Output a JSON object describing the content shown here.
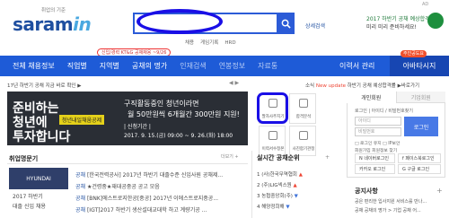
{
  "header": {
    "tagline": "취업의 기준",
    "logo_text": "saram",
    "logo_suffix": "in",
    "search_placeholder": "",
    "advanced_search": "상세검색",
    "sublinks": [
      "채용",
      "게임기록",
      "HRD"
    ],
    "promo_badge": "신입/경력 KT&G 공채채용 ~9/26",
    "ad_line1": "2017 하반기 공채 예상합격",
    "ad_line2": "미리 미리 준비하세요!",
    "ad_tag": "AD"
  },
  "nav": {
    "items": [
      "전체 채용정보",
      "직업별",
      "지역별",
      "공채의 명가",
      "인재검색",
      "연봉정보",
      "자료통"
    ],
    "dim_from": 4,
    "resume": "이력서 관리",
    "partner": "아바타시지",
    "partner_badge": "주인공도요"
  },
  "notices": {
    "left": "17년 하반기 공채 지금 바로 확인 ▶",
    "right_prefix": "소식",
    "right_highlight": "New update",
    "right_text": "하반기 공채 예상합격률 ▶바로가기"
  },
  "banner": {
    "line1": "준비하는",
    "line2": "청년에",
    "line3": "투자합니다",
    "tag": "청년내일채움공제",
    "r1": "구직활동중인 청년이라면",
    "r2": "월 50만원씩 6개월간 300만원 지원!",
    "r3": "| 신청기간 |",
    "r4": "2017. 9. 15.(금) 09:00 ~ 9. 26.(화) 18:00",
    "nav_text": "◀  ▶"
  },
  "tiles": [
    {
      "icon": "chart-icon",
      "label": "팔자사주지기"
    },
    {
      "icon": "check-icon",
      "label": "합격분석"
    },
    {
      "icon": "doc-icon",
      "label": "이력서수정본"
    },
    {
      "icon": "mail-icon",
      "label": "사진합기관정"
    }
  ],
  "login": {
    "tab_personal": "개인회원",
    "tab_company": "기업회원",
    "options": "로그인 | 아이디 / 비밀번호찾기",
    "id_placeholder": "아이디",
    "pw_placeholder": "비밀번호",
    "login_button": "로그인",
    "keep_login": "□ 로그인 유지   □ IP보안",
    "join": "회원가입    회원정보 찾기",
    "sns": [
      "N 네이버로그인",
      "f 페이스북로그인",
      "카카오 로그인",
      "G 구글 로그인"
    ]
  },
  "company_section": {
    "title": "취업명문기",
    "more": "더보기 +",
    "logo_text": "HYUNDAI",
    "caption1": "2017 하반기",
    "caption2": "대졸 신입 채용",
    "rows": [
      {
        "tag": "공채",
        "text": "[한국전력공사] 2017년 하반기 대졸수준 신입사원 공채제..."
      },
      {
        "tag": "공채",
        "text": "★건령중★재대공중공 공고 모음"
      },
      {
        "tag": "공채",
        "text": "[BNK]에스트로지한공[중공] 2017년 이에스트로지중공..."
      },
      {
        "tag": "공채",
        "text": "[IGT]2017 하반기 생산설대교대학 하고 계량기공 ..."
      }
    ]
  },
  "ranking": {
    "title": "실시간 공채순위",
    "more": "+",
    "rows": [
      {
        "num": "1",
        "name": "(사)한국무역협회",
        "dir": "up"
      },
      {
        "num": "2",
        "name": "(주)LIG넥스원",
        "dir": "up"
      },
      {
        "num": "3",
        "name": "농협중앙회(주)",
        "dir": "dn"
      },
      {
        "num": "4",
        "name": "해양정희해",
        "dir": "dn"
      }
    ]
  },
  "notice_box": {
    "title": "공지사항",
    "more": "+",
    "items": [
      "공은  편리한 입사지원 서비스를 만나...",
      "공채  공채의 명가 > 기업 공채 어..."
    ]
  }
}
